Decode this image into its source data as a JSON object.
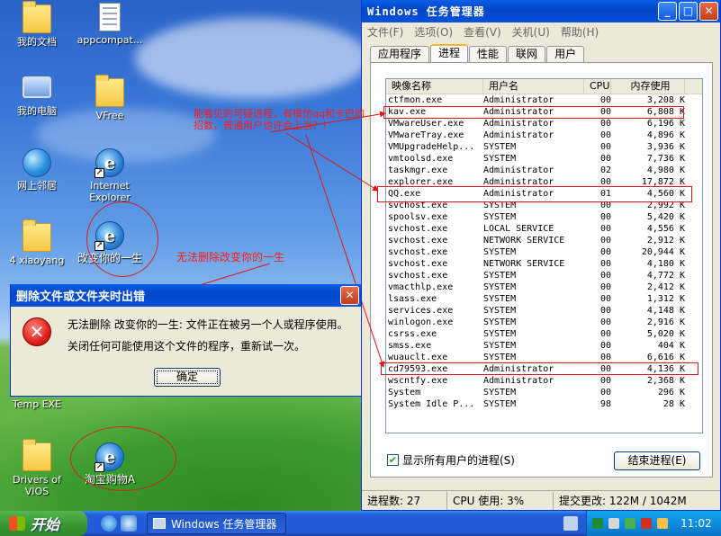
{
  "desktop": {
    "icons": [
      {
        "label": "我的文档",
        "icon": "my-documents-icon"
      },
      {
        "label": "appcompat...",
        "icon": "text-file-icon"
      },
      {
        "label": "我的电脑",
        "icon": "my-computer-icon"
      },
      {
        "label": "VFree",
        "icon": "folder-icon"
      },
      {
        "label": "网上邻居",
        "icon": "network-places-icon"
      },
      {
        "label": "Internet Explorer",
        "icon": "ie-icon"
      },
      {
        "label": "4 xiaoyang",
        "icon": "folder-icon"
      },
      {
        "label": "改变你的一生",
        "icon": "ie-shortcut-icon"
      },
      {
        "label": "Temp EXE",
        "icon": "folder-icon"
      },
      {
        "label": "Drivers of VIOS",
        "icon": "folder-icon"
      },
      {
        "label": "淘宝购物A",
        "icon": "ie-shortcut-icon"
      }
    ]
  },
  "annotations": {
    "note1": "能看见的可疑进程，有模仿qq和卡巴的招数，普通用户也许会上当？！",
    "note2": "无法删除改变你的一生"
  },
  "dialog": {
    "title": "删除文件或文件夹时出错",
    "close": "✕",
    "message1": "无法删除 改变你的一生: 文件正在被另一个人或程序使用。",
    "message2": "关闭任何可能使用这个文件的程序，重新试一次。",
    "ok": "确定"
  },
  "taskmgr": {
    "title": "Windows 任务管理器",
    "buttons": {
      "min": "_",
      "max": "□",
      "close": "✕"
    },
    "menu": [
      "文件(F)",
      "选项(O)",
      "查看(V)",
      "关机(U)",
      "帮助(H)"
    ],
    "tabs": [
      "应用程序",
      "进程",
      "性能",
      "联网",
      "用户"
    ],
    "columns": [
      "映像名称",
      "用户名",
      "CPU",
      "内存使用"
    ],
    "processes": [
      [
        "ctfmon.exe",
        "Administrator",
        "00",
        "3,208 K"
      ],
      [
        "kav.exe",
        "Administrator",
        "00",
        "6,808 K"
      ],
      [
        "VMwareUser.exe",
        "Administrator",
        "00",
        "6,196 K"
      ],
      [
        "VMwareTray.exe",
        "Administrator",
        "00",
        "4,896 K"
      ],
      [
        "VMUpgradeHelp...",
        "SYSTEM",
        "00",
        "3,936 K"
      ],
      [
        "vmtoolsd.exe",
        "SYSTEM",
        "00",
        "7,736 K"
      ],
      [
        "taskmgr.exe",
        "Administrator",
        "02",
        "4,980 K"
      ],
      [
        "explorer.exe",
        "Administrator",
        "00",
        "17,872 K"
      ],
      [
        "QQ.exe",
        "Administrator",
        "01",
        "4,560 K"
      ],
      [
        "svchost.exe",
        "SYSTEM",
        "00",
        "2,992 K"
      ],
      [
        "spoolsv.exe",
        "SYSTEM",
        "00",
        "5,420 K"
      ],
      [
        "svchost.exe",
        "LOCAL SERVICE",
        "00",
        "4,556 K"
      ],
      [
        "svchost.exe",
        "NETWORK SERVICE",
        "00",
        "2,912 K"
      ],
      [
        "svchost.exe",
        "SYSTEM",
        "00",
        "20,944 K"
      ],
      [
        "svchost.exe",
        "NETWORK SERVICE",
        "00",
        "4,180 K"
      ],
      [
        "svchost.exe",
        "SYSTEM",
        "00",
        "4,772 K"
      ],
      [
        "vmacthlp.exe",
        "SYSTEM",
        "00",
        "2,412 K"
      ],
      [
        "lsass.exe",
        "SYSTEM",
        "00",
        "1,312 K"
      ],
      [
        "services.exe",
        "SYSTEM",
        "00",
        "4,148 K"
      ],
      [
        "winlogon.exe",
        "SYSTEM",
        "00",
        "2,916 K"
      ],
      [
        "csrss.exe",
        "SYSTEM",
        "00",
        "5,020 K"
      ],
      [
        "smss.exe",
        "SYSTEM",
        "00",
        "404 K"
      ],
      [
        "wuauclt.exe",
        "SYSTEM",
        "00",
        "6,616 K"
      ],
      [
        "cd79593.exe",
        "Administrator",
        "00",
        "4,136 K"
      ],
      [
        "wscntfy.exe",
        "Administrator",
        "00",
        "2,368 K"
      ],
      [
        "System",
        "SYSTEM",
        "00",
        "296 K"
      ],
      [
        "System Idle P...",
        "SYSTEM",
        "98",
        "28 K"
      ]
    ],
    "show_all": "显示所有用户的进程(S)",
    "end_process": "结束进程(E)",
    "status": {
      "procs": "进程数: 27",
      "cpu": "CPU 使用: 3%",
      "commit": "提交更改: 122M / 1042M"
    }
  },
  "taskbar": {
    "start": "开始",
    "task": "Windows 任务管理器",
    "clock": "11:02"
  },
  "colors": {
    "annotation": "#ff1a1a",
    "xp_blue": "#0a5fe8"
  }
}
